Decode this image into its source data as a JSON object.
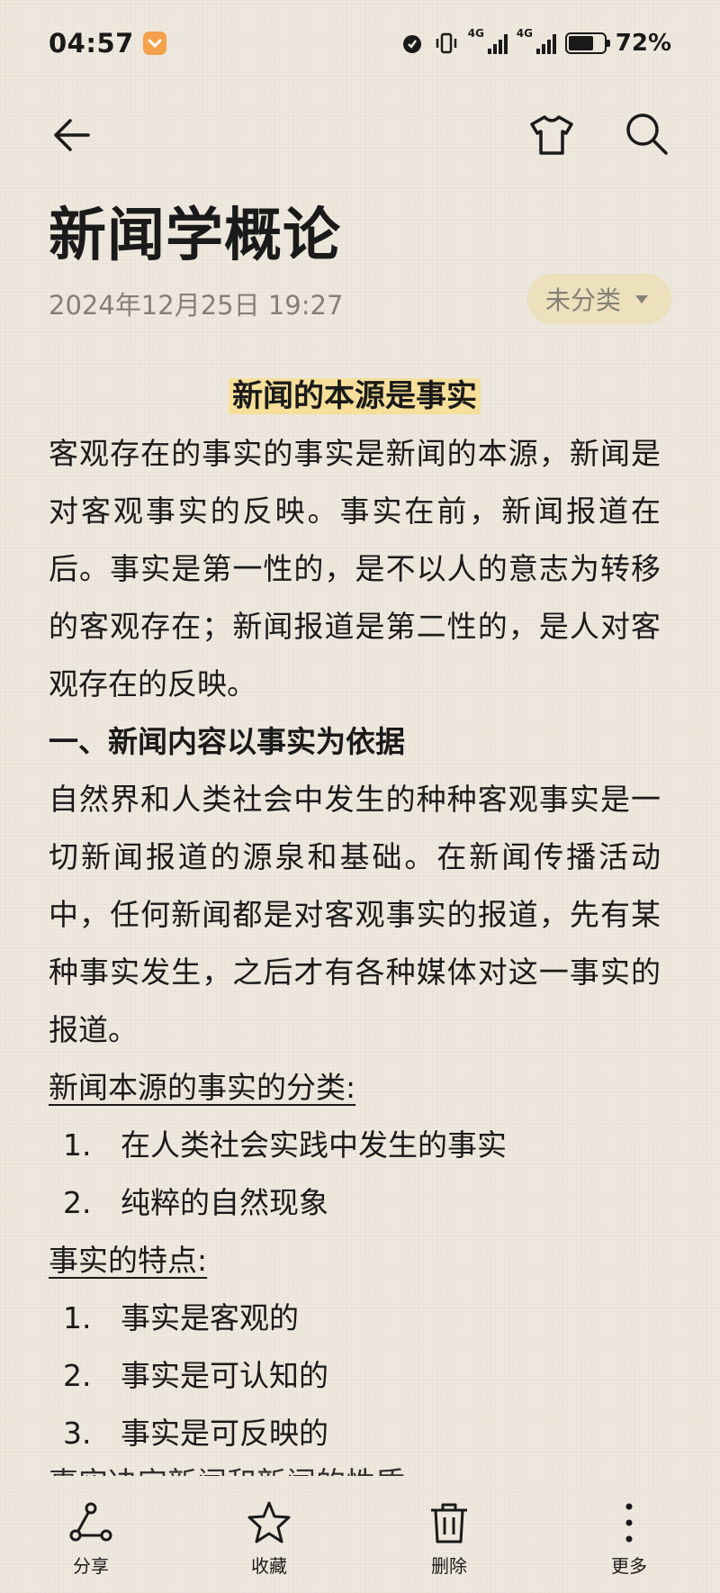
{
  "status_bar": {
    "time": "04:57",
    "network_1": "4G",
    "network_2": "4G",
    "battery_percent": "72%",
    "battery_level": 0.72
  },
  "header": {
    "back_icon": "back-arrow-icon",
    "theme_icon": "tshirt-icon",
    "search_icon": "search-icon"
  },
  "note": {
    "title": "新闻学概论",
    "date": "2024年12月25日 19:27",
    "category": "未分类",
    "heading": "新闻的本源是事实",
    "paragraph1": "客观存在的事实的事实是新闻的本源，新闻是对客观事实的反映。事实在前，新闻报道在后。事实是第一性的，是不以人的意志为转移的客观存在；新闻报道是第二性的，是人对客观存在的反映。",
    "section1_title": "一、新闻内容以事实为依据",
    "paragraph2": "自然界和人类社会中发生的种种客观事实是一切新闻报道的源泉和基础。在新闻传播活动中，任何新闻都是对客观事实的报道，先有某种事实发生，之后才有各种媒体对这一事实的报道。",
    "list1_title": "新闻本源的事实的分类:",
    "list1": [
      {
        "num": "1.",
        "text": "在人类社会实践中发生的事实"
      },
      {
        "num": "2.",
        "text": "纯粹的自然现象"
      }
    ],
    "list2_title": "事实的特点:",
    "list2": [
      {
        "num": "1.",
        "text": "事实是客观的"
      },
      {
        "num": "2.",
        "text": "事实是可认知的"
      },
      {
        "num": "3.",
        "text": "事实是可反映的"
      }
    ],
    "cut_line": "事实决定新闻和新闻的性质"
  },
  "toolbar": {
    "share_label": "分享",
    "favorite_label": "收藏",
    "delete_label": "删除",
    "more_label": "更多"
  },
  "colors": {
    "background": "#eee8de",
    "highlight": "#f6df9a",
    "category_bg": "#ece0bd",
    "muted_text": "#858076"
  }
}
